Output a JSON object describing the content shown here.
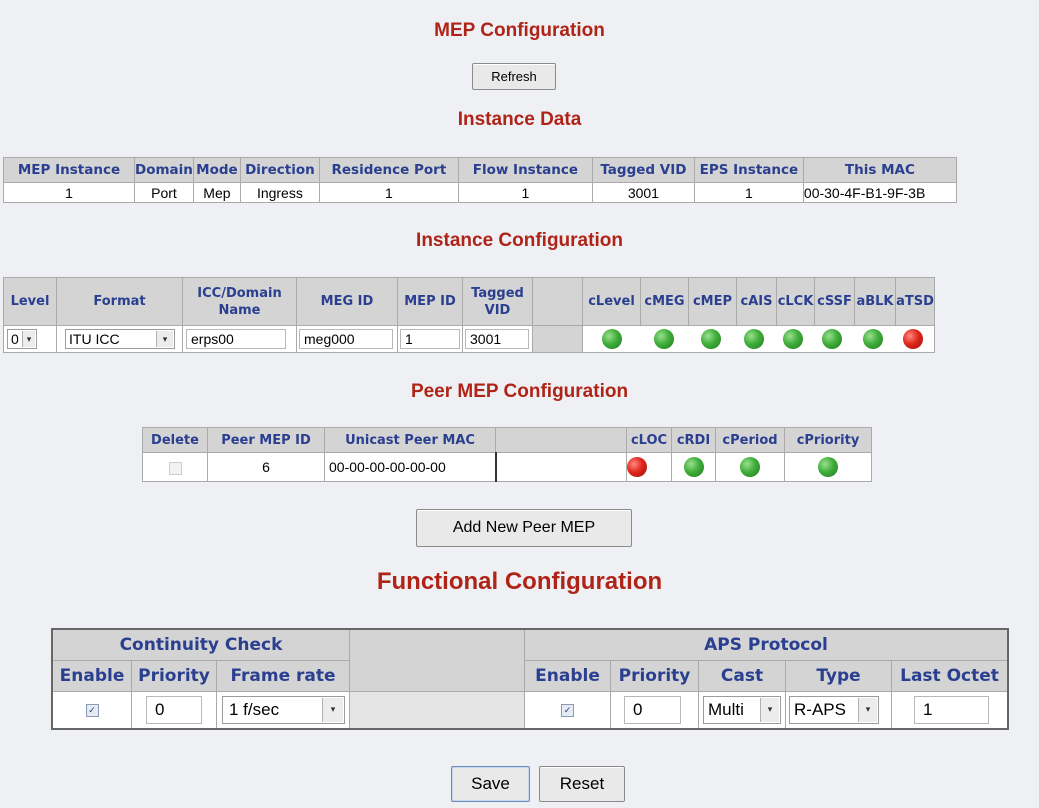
{
  "title": "MEP Configuration",
  "refresh_label": "Refresh",
  "instance_data": {
    "heading": "Instance Data",
    "headers": [
      "MEP Instance",
      "Domain",
      "Mode",
      "Direction",
      "Residence Port",
      "Flow Instance",
      "Tagged VID",
      "EPS Instance",
      "This MAC"
    ],
    "row": [
      "1",
      "Port",
      "Mep",
      "Ingress",
      "1",
      "1",
      "3001",
      "1",
      "00-30-4F-B1-9F-3B"
    ]
  },
  "instance_config": {
    "heading": "Instance Configuration",
    "headers": {
      "level": "Level",
      "format": "Format",
      "icc_domain": "ICC/Domain Name",
      "meg_id": "MEG ID",
      "mep_id": "MEP ID",
      "tagged_vid": "Tagged VID"
    },
    "status_headers": [
      "cLevel",
      "cMEG",
      "cMEP",
      "cAIS",
      "cLCK",
      "cSSF",
      "aBLK",
      "aTSD"
    ],
    "status_colors": [
      "green",
      "green",
      "green",
      "green",
      "green",
      "green",
      "green",
      "red"
    ],
    "values": {
      "level": "0",
      "format": "ITU ICC",
      "icc_domain": "erps00",
      "meg_id": "meg000",
      "mep_id": "1",
      "tagged_vid": "3001"
    }
  },
  "peer_mep": {
    "heading": "Peer MEP Configuration",
    "headers": [
      "Delete",
      "Peer MEP ID",
      "Unicast Peer MAC"
    ],
    "status_headers": [
      "cLOC",
      "cRDI",
      "cPeriod",
      "cPriority"
    ],
    "status_colors": [
      "red",
      "green",
      "green",
      "green"
    ],
    "row": {
      "peer_mep_id": "6",
      "unicast_mac": "00-00-00-00-00-00"
    },
    "add_label": "Add New Peer MEP"
  },
  "functional": {
    "heading": "Functional Configuration",
    "cc_heading": "Continuity Check",
    "aps_heading": "APS Protocol",
    "cc_headers": [
      "Enable",
      "Priority",
      "Frame rate"
    ],
    "aps_headers": [
      "Enable",
      "Priority",
      "Cast",
      "Type",
      "Last Octet"
    ],
    "cc_values": {
      "priority": "0",
      "frame_rate": "1 f/sec"
    },
    "aps_values": {
      "priority": "0",
      "cast": "Multi",
      "type": "R-APS",
      "last_octet": "1"
    }
  },
  "save_label": "Save",
  "reset_label": "Reset"
}
